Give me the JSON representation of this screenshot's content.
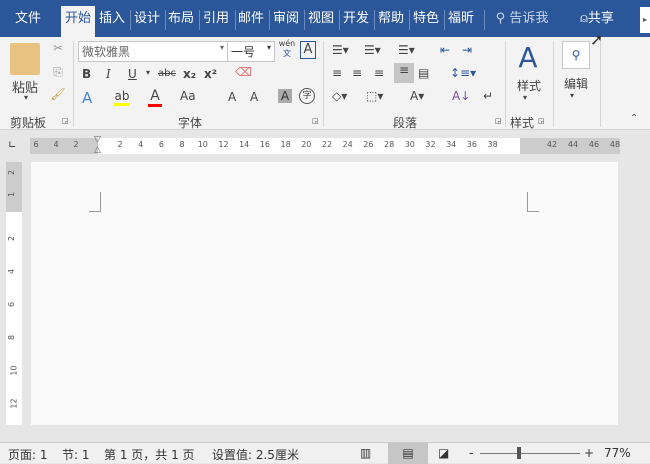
{
  "tabs": [
    {
      "label": "文件"
    },
    {
      "label": "开始"
    },
    {
      "label": "插入"
    },
    {
      "label": "设计"
    },
    {
      "label": "布局"
    },
    {
      "label": "引用"
    },
    {
      "label": "邮件"
    },
    {
      "label": "审阅"
    },
    {
      "label": "视图"
    },
    {
      "label": "开发"
    },
    {
      "label": "帮助"
    },
    {
      "label": "特色"
    },
    {
      "label": "福昕"
    }
  ],
  "tell_me": "告诉我",
  "share": "共享",
  "ribbon": {
    "paste": "粘贴",
    "font_name": "微软雅黑",
    "font_size": "一号",
    "phonetic": "wén",
    "phonetic_char": "文",
    "bold": "B",
    "italic": "I",
    "underline": "U",
    "strike": "abc",
    "sub": "x₂",
    "sup": "x²",
    "case": "Aa",
    "grow": "A",
    "shrink": "A",
    "shade": "A",
    "enclose": "字",
    "styles": "样式",
    "editing": "编辑",
    "groups": {
      "clipboard": "剪贴板",
      "font": "字体",
      "paragraph": "段落",
      "styles": "样式"
    }
  },
  "ruler": {
    "left": [
      "6",
      "4",
      "2"
    ],
    "main": [
      "2",
      "4",
      "6",
      "8",
      "10",
      "12",
      "14",
      "16",
      "18",
      "20",
      "22",
      "24",
      "26",
      "28",
      "30",
      "32",
      "34",
      "36",
      "38"
    ],
    "right": [
      "42",
      "44",
      "46",
      "48"
    ],
    "vertical": [
      "2",
      "1",
      "2",
      "4",
      "6",
      "8",
      "10",
      "12"
    ]
  },
  "status": {
    "page": "页面: 1",
    "section": "节: 1",
    "pages": "第 1 页，共 1 页",
    "setting": "设置值: 2.5厘米",
    "zoom": "77%",
    "zoom_level": 77
  },
  "colors": {
    "brand": "#2b579a",
    "highlight": "#ffff00",
    "font_color": "#ff0000"
  }
}
